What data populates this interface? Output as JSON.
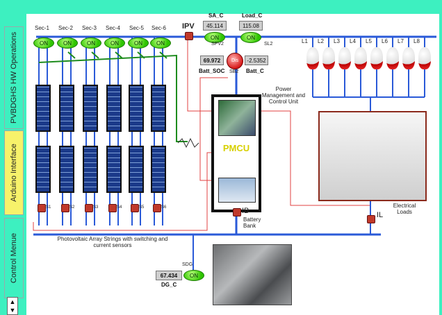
{
  "sidebar": {
    "tabs": [
      {
        "label": "PVBDGHS HW Operations"
      },
      {
        "label": "Arduino Interface"
      },
      {
        "label": "Control Menue"
      }
    ]
  },
  "pv": {
    "label": "IPV",
    "sections": [
      "Sec-1",
      "Sec-2",
      "Sec-3",
      "Sec-4",
      "Sec-5",
      "Sec-6"
    ],
    "switch_state": "ON",
    "sensor_labels": [
      "S1",
      "S2",
      "S3",
      "S4",
      "S5",
      "S6"
    ],
    "caption": "Photovoltaic Array Strings with switching and current sensors"
  },
  "top": {
    "sa_c_label": "SA_C",
    "sa_c_value": "45.114",
    "load_c_label": "Load_C",
    "load_c_value": "115.08",
    "spv2_label": "SPV2",
    "sl2_label": "SL2",
    "on": "ON"
  },
  "battery": {
    "soc_value": "69.972",
    "soc_label": "Batt_SOC",
    "dis_label": "Dis",
    "sb2_label": "SB2",
    "batt_c_value": "-2.5352",
    "batt_c_label": "Batt_C",
    "ib_label": "IB",
    "bank_label": "Battery Bank"
  },
  "pmcu": {
    "title": "Power Management and Control Unit",
    "label": "PMCU"
  },
  "loads": {
    "items": [
      "L1",
      "L2",
      "L3",
      "L4",
      "L5",
      "L6",
      "L7",
      "L8"
    ],
    "il_label": "IL",
    "title": "Electrical Loads"
  },
  "dg": {
    "sdg_label": "SDG",
    "on": "ON",
    "value": "67.434",
    "label": "DG_C"
  },
  "colors": {
    "bg": "#3df0c0",
    "bus": "#2a5ad8",
    "wire_red": "#e04040",
    "arrow": "#1e8c1e"
  }
}
